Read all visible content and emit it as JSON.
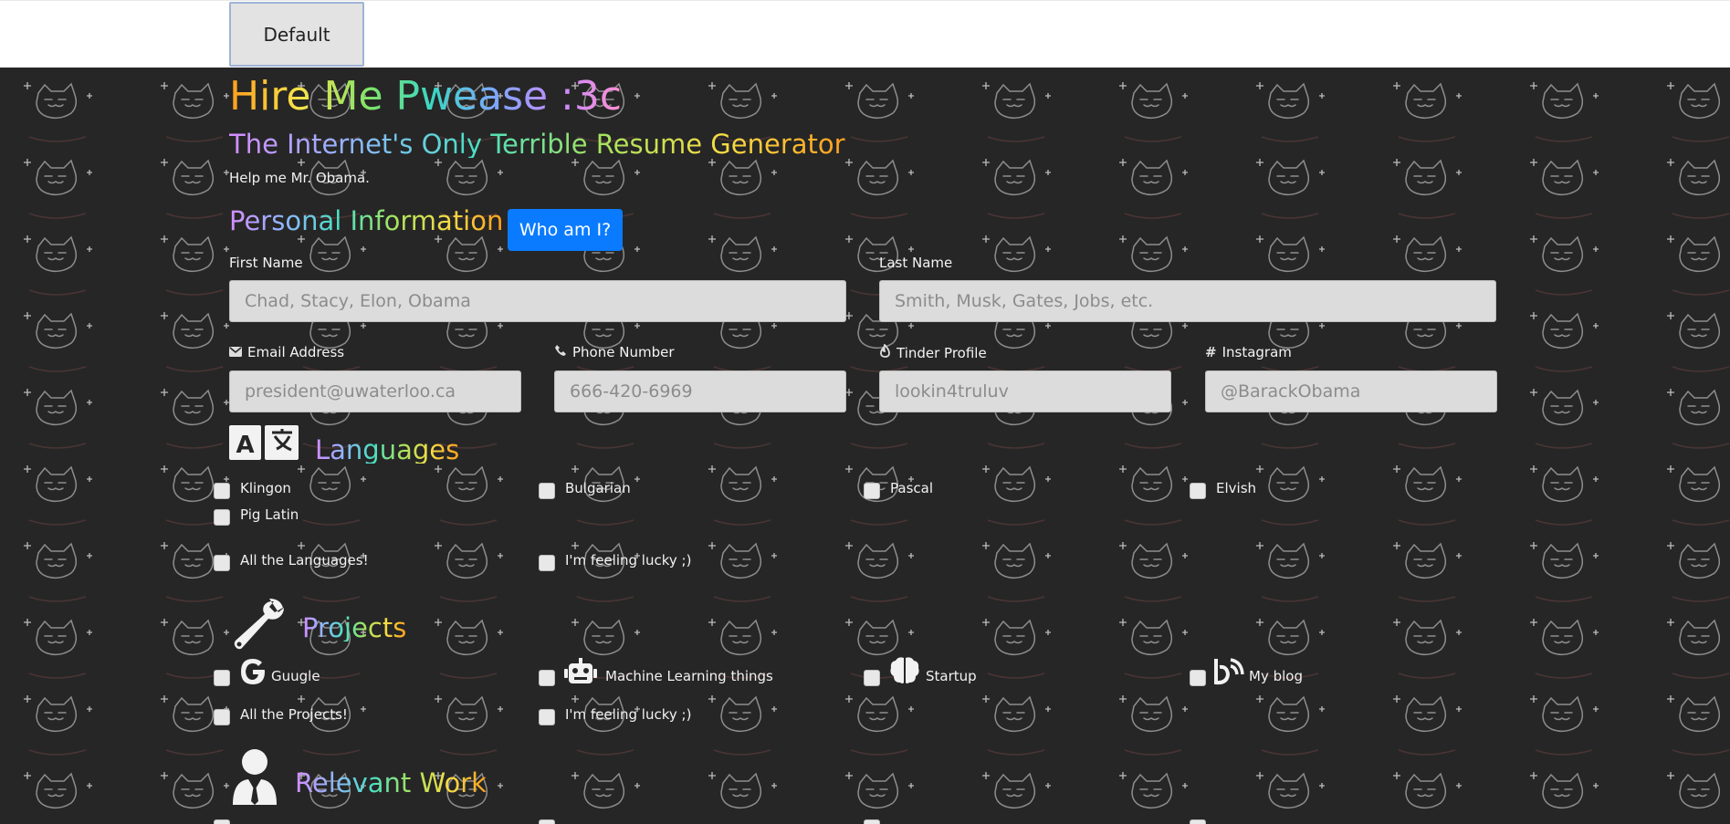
{
  "toolbar": {
    "default_label": "Default"
  },
  "header": {
    "title": "Hire Me Pwease :3c",
    "subtitle": "The Internet's Only Terrible Resume Generator",
    "tagline": "Help me Mr. Obama."
  },
  "personal": {
    "heading": "Personal Information",
    "who_button": "Who am I?",
    "first_name": {
      "label": "First Name",
      "placeholder": "Chad, Stacy, Elon, Obama",
      "value": ""
    },
    "last_name": {
      "label": "Last Name",
      "placeholder": "Smith, Musk, Gates, Jobs, etc.",
      "value": ""
    },
    "email": {
      "label": "Email Address",
      "placeholder": "president@uwaterloo.ca",
      "icon": "envelope-icon"
    },
    "phone": {
      "label": "Phone Number",
      "placeholder": "666-420-6969",
      "icon": "phone-icon"
    },
    "tinder": {
      "label": "Tinder Profile",
      "placeholder": "lookin4truluv",
      "icon": "flame-icon"
    },
    "instagram": {
      "label": "Instagram",
      "placeholder": "@BarackObama",
      "icon": "hashtag-icon"
    }
  },
  "languages": {
    "heading": "Languages",
    "icon": "translate-icon",
    "options": [
      "Klingon",
      "Bulgarian",
      "Pascal",
      "Elvish",
      "Pig Latin"
    ],
    "extras": [
      "All the Languages!",
      "I'm feeling lucky ;)"
    ]
  },
  "projects": {
    "heading": "Projects",
    "icon": "wrench-icon",
    "options": [
      {
        "label": "Guugle",
        "icon": "google-icon"
      },
      {
        "label": "Machine Learning things",
        "icon": "robot-icon"
      },
      {
        "label": "Startup",
        "icon": "brain-icon"
      },
      {
        "label": "My blog",
        "icon": "blog-icon"
      }
    ],
    "extras": [
      "All the Projects!",
      "I'm feeling lucky ;)"
    ]
  },
  "work": {
    "heading": "Relevant Work",
    "icon": "user-tie-icon"
  },
  "colors": {
    "background": "#262626",
    "accent_blue": "#0a7bff"
  }
}
